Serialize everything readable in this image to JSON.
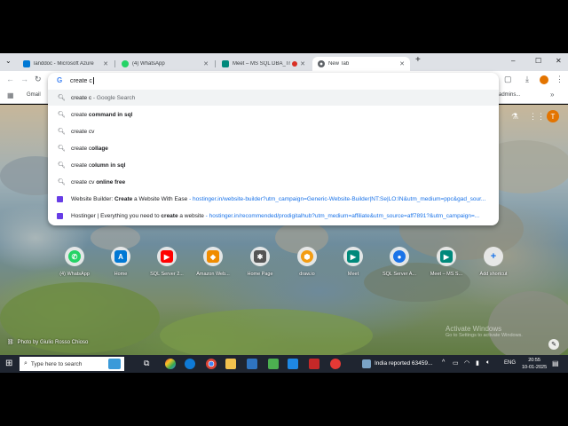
{
  "tabs": [
    {
      "title": "landdoc - Microsoft Azure",
      "color": "#0078d4"
    },
    {
      "title": "(4) WhatsApp",
      "color": "#25d366"
    },
    {
      "title": "Meet – MS SQL DBA_Train",
      "color": "#00897b"
    },
    {
      "title": "New Tab",
      "color": "#5f6368"
    }
  ],
  "new_tab_symbol": "+",
  "window_controls": {
    "minimize": "–",
    "maximize": "☐",
    "close": "✕",
    "chevron": "⌄"
  },
  "omnibox": {
    "icon_letter": "G",
    "value": "create c",
    "suggestions": [
      {
        "typed": "create c",
        "rest": "",
        "sub": " - Google Search"
      },
      {
        "typed": "create ",
        "rest": "command in sql",
        "sub": ""
      },
      {
        "typed": "create cv",
        "rest": "",
        "sub": ""
      },
      {
        "typed": "create c",
        "rest": "ollage",
        "sub": ""
      },
      {
        "typed": "create c",
        "rest": "olumn in sql",
        "sub": ""
      },
      {
        "typed": "create cv ",
        "rest": "online free",
        "sub": ""
      }
    ],
    "site_suggestions": [
      {
        "pre": "Website Builder: ",
        "bold": "Create",
        "post": " a Website With Ease",
        "url": " - hostinger.in/website-builder?utm_campaign=Generic-Website-Builder|NT:Se|LO:IN&utm_medium=ppc&gad_sour..."
      },
      {
        "pre": "Hostinger | Everything you need to ",
        "bold": "create",
        "post": " a website",
        "url": " - hostinger.in/recommended/prodigitalhub?utm_medium=affiliate&utm_source=aff7891?&utm_campaign=..."
      }
    ]
  },
  "bookmarks": {
    "first": "Gmail",
    "last": "admins..."
  },
  "shortcuts": [
    {
      "label": "(4) WhatsApp",
      "color": "#25d366",
      "glyph": "✆"
    },
    {
      "label": "Home",
      "color": "#0078d4",
      "glyph": "A"
    },
    {
      "label": "SQL Server 2...",
      "color": "#ff0000",
      "glyph": "▶"
    },
    {
      "label": "Amazon Web...",
      "color": "#f08c00",
      "glyph": "◆"
    },
    {
      "label": "Home Page",
      "color": "#555555",
      "glyph": "✱"
    },
    {
      "label": "draw.io",
      "color": "#f39c12",
      "glyph": "⬢"
    },
    {
      "label": "Meet",
      "color": "#00897b",
      "glyph": "▶"
    },
    {
      "label": "SQL Server A...",
      "color": "#1a73e8",
      "glyph": "●"
    },
    {
      "label": "Meet – MS S...",
      "color": "#00897b",
      "glyph": "▶"
    },
    {
      "label": "Add shortcut",
      "color": "#8ab4f8",
      "glyph": "+"
    }
  ],
  "photo_credit": "Photo by Giulio Rosso Chioso",
  "watermark": {
    "line1": "Activate Windows",
    "line2": "Go to Settings to activate Windows."
  },
  "taskbar": {
    "search_placeholder": "Type here to search",
    "news": "India reported 63459...",
    "lang": "ENG",
    "time": "20:55",
    "date": "10-01-2025"
  }
}
